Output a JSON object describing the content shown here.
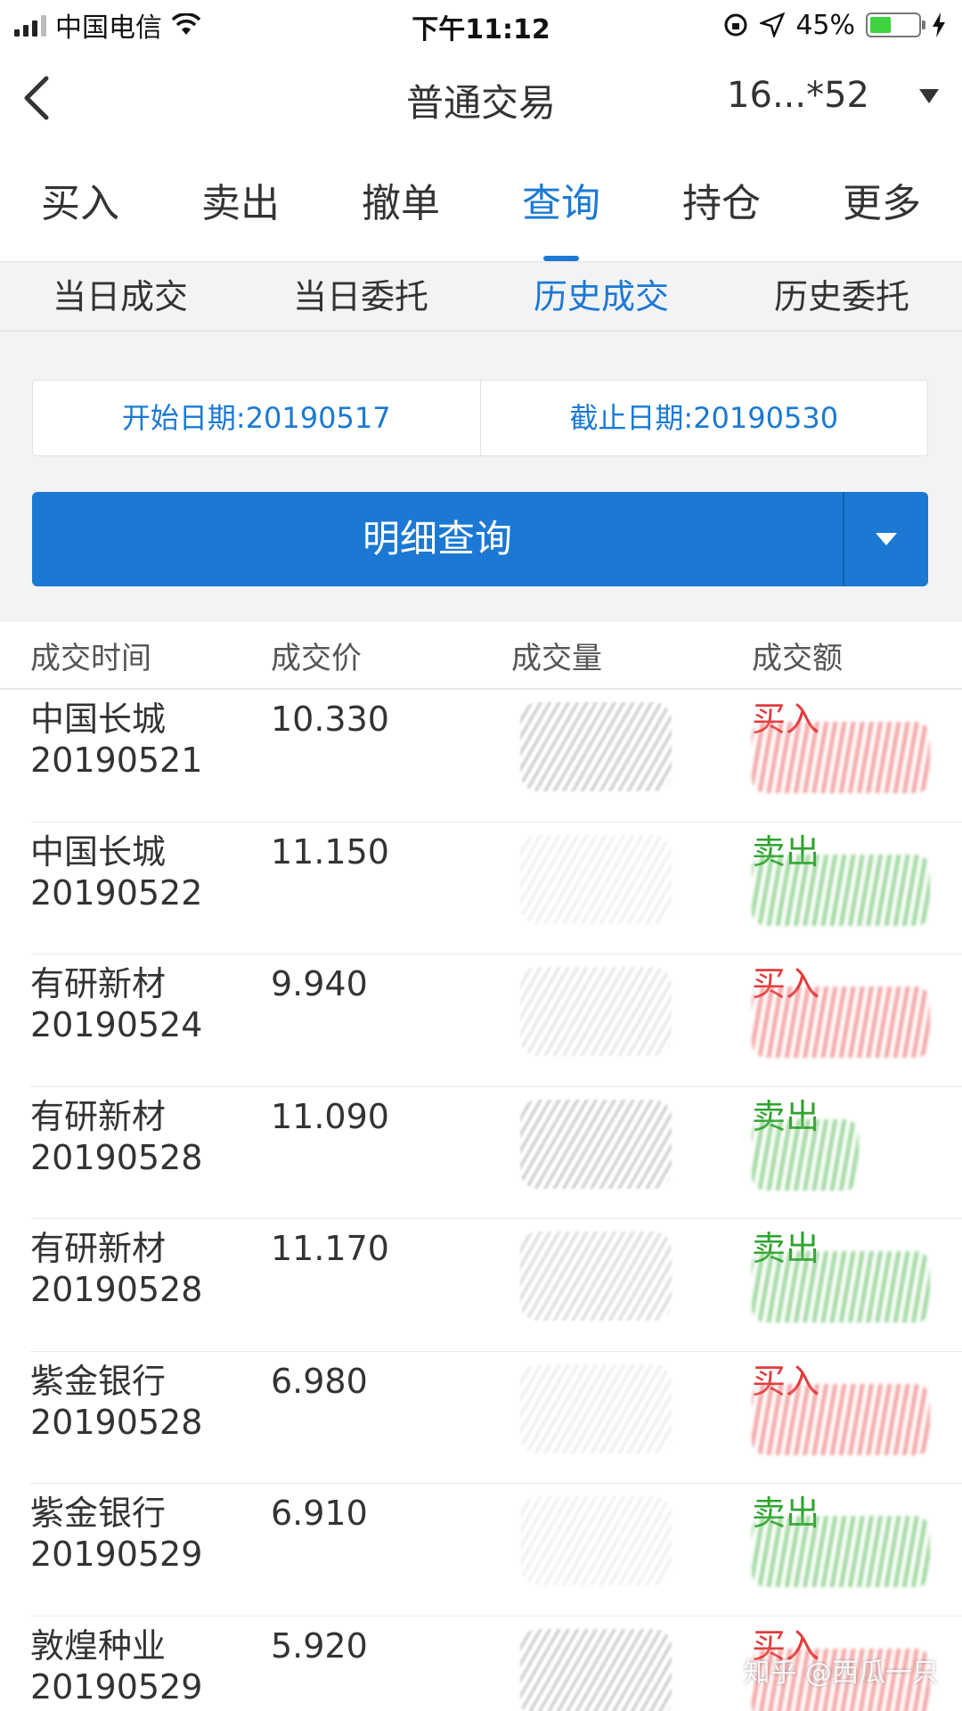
{
  "status_bar": {
    "carrier": "中国电信",
    "time": "下午11:12",
    "battery": "45%"
  },
  "navbar": {
    "title": "普通交易",
    "account": "16...*52"
  },
  "main_tabs": [
    "买入",
    "卖出",
    "撤单",
    "查询",
    "持仓",
    "更多"
  ],
  "sub_tabs": [
    "当日成交",
    "当日委托",
    "历史成交",
    "历史委托"
  ],
  "dates": {
    "start": "开始日期:20190517",
    "end": "截止日期:20190530"
  },
  "query_button": "明细查询",
  "table": {
    "headers": [
      "成交时间",
      "成交价",
      "成交量",
      "成交额"
    ],
    "rows": [
      {
        "name": "中国长城",
        "date": "20190521",
        "price": "10.330",
        "side": "买入"
      },
      {
        "name": "中国长城",
        "date": "20190522",
        "price": "11.150",
        "side": "卖出"
      },
      {
        "name": "有研新材",
        "date": "20190524",
        "price": "9.940",
        "side": "买入"
      },
      {
        "name": "有研新材",
        "date": "20190528",
        "price": "11.090",
        "side": "卖出"
      },
      {
        "name": "有研新材",
        "date": "20190528",
        "price": "11.170",
        "side": "卖出"
      },
      {
        "name": "紫金银行",
        "date": "20190528",
        "price": "6.980",
        "side": "买入"
      },
      {
        "name": "紫金银行",
        "date": "20190529",
        "price": "6.910",
        "side": "卖出"
      },
      {
        "name": "敦煌种业",
        "date": "20190529",
        "price": "5.920",
        "side": "买入"
      }
    ]
  },
  "watermark": "知乎 @西瓜一只",
  "colors": {
    "accent": "#1b79d3",
    "buy": "#e03c3c",
    "sell": "#2fa32f"
  }
}
